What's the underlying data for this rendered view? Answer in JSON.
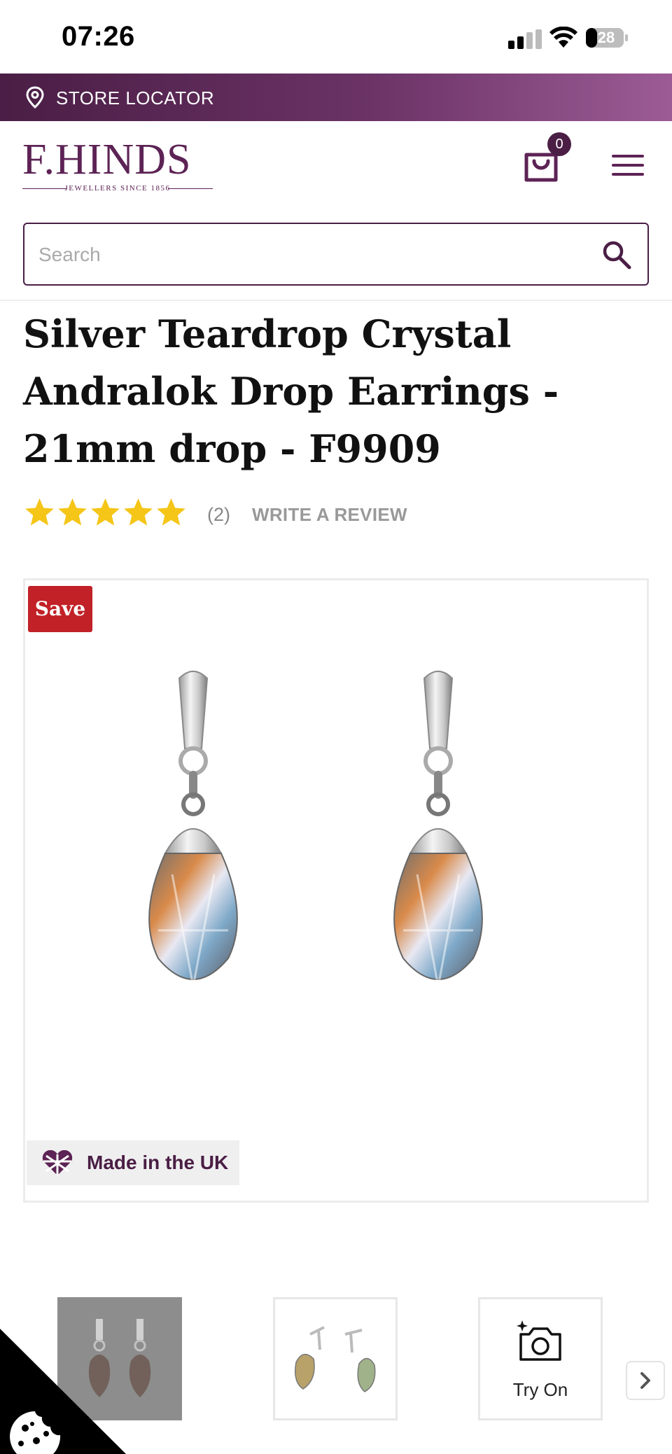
{
  "status_bar": {
    "time": "07:26",
    "battery": "28"
  },
  "store_locator": {
    "label": "STORE LOCATOR"
  },
  "header": {
    "logo_text": "F.HINDS",
    "logo_tagline": "JEWELLERS SINCE 1856",
    "cart_count": "0"
  },
  "search": {
    "placeholder": "Search",
    "value": ""
  },
  "product": {
    "title": "Silver Teardrop Crystal Andralok Drop Earrings - 21mm drop - F9909",
    "rating_stars": 5,
    "review_count": "(2)",
    "write_review": "WRITE A REVIEW",
    "save_badge": "Save",
    "made_in": "Made in the UK"
  },
  "thumbnails": [
    {
      "name": "front-view"
    },
    {
      "name": "side-view"
    },
    {
      "name": "try-on",
      "label": "Try On"
    }
  ],
  "colors": {
    "brand_purple": "#5d2355",
    "dark_purple": "#4a1e45",
    "star_yellow": "#f5c518",
    "save_red": "#c12127"
  }
}
